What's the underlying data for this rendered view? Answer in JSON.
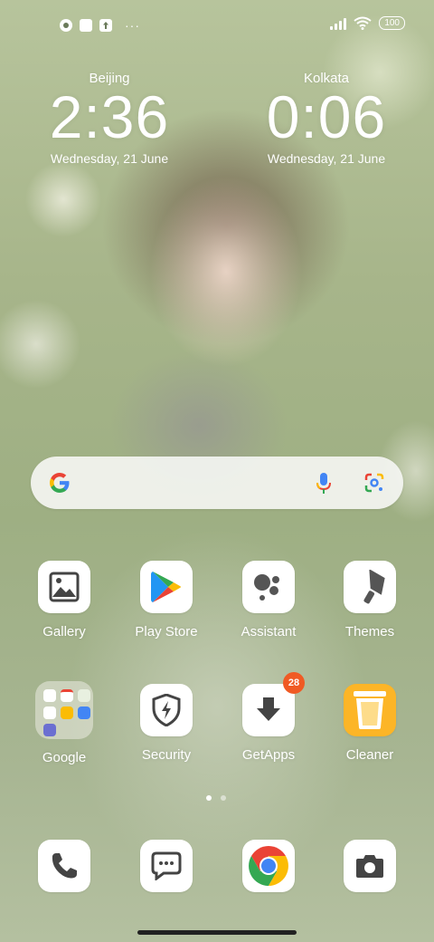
{
  "status_bar": {
    "left_icons": [
      "notification-icon",
      "square-notification-icon",
      "upload-icon"
    ],
    "more_dots": "···",
    "battery": "100"
  },
  "clocks": [
    {
      "city": "Beijing",
      "time": "2:36",
      "date": "Wednesday, 21 June"
    },
    {
      "city": "Kolkata",
      "time": "0:06",
      "date": "Wednesday, 21 June"
    }
  ],
  "search": {
    "icons": [
      "google-g-icon",
      "mic-icon",
      "lens-icon"
    ]
  },
  "apps_row1": [
    {
      "label": "Gallery",
      "icon": "gallery-icon"
    },
    {
      "label": "Play Store",
      "icon": "play-store-icon"
    },
    {
      "label": "Assistant",
      "icon": "assistant-icon"
    },
    {
      "label": "Themes",
      "icon": "themes-icon"
    }
  ],
  "apps_row2": [
    {
      "label": "Google",
      "icon": "folder-icon"
    },
    {
      "label": "Security",
      "icon": "security-icon"
    },
    {
      "label": "GetApps",
      "icon": "getapps-icon",
      "badge": "28"
    },
    {
      "label": "Cleaner",
      "icon": "cleaner-icon"
    }
  ],
  "dock": [
    {
      "icon": "phone-icon"
    },
    {
      "icon": "messages-icon"
    },
    {
      "icon": "chrome-icon"
    },
    {
      "icon": "camera-icon"
    }
  ],
  "page_indicator": {
    "count": 2,
    "active": 1
  },
  "colors": {
    "badge": "#f05a24",
    "accent_blue": "#4285f4"
  }
}
